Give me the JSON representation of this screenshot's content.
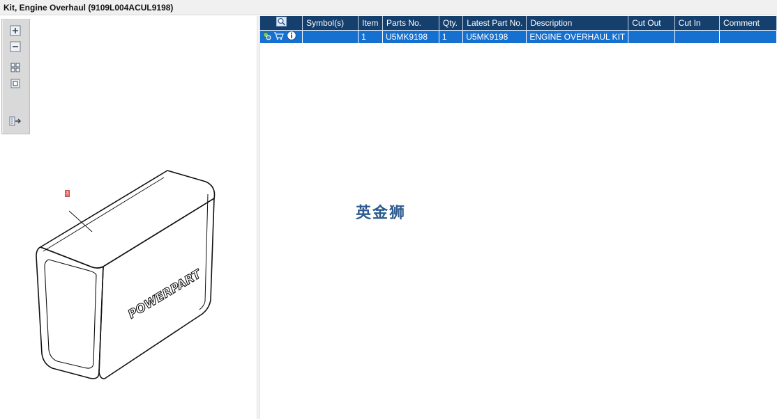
{
  "window": {
    "title": "Kit, Engine Overhaul (9109L004ACUL9198)"
  },
  "toolbar": {
    "buttons": [
      {
        "name": "zoom-in-icon"
      },
      {
        "name": "zoom-out-icon"
      },
      {
        "name": "fit-all-icon"
      },
      {
        "name": "actual-size-icon"
      },
      {
        "name": "panel-toggle-icon"
      }
    ]
  },
  "drawing": {
    "callout": "1",
    "brand_text": "POWERPART"
  },
  "table": {
    "headers": {
      "view": "",
      "symbols": "Symbol(s)",
      "item": "Item",
      "parts_no": "Parts No.",
      "qty": "Qty.",
      "latest_part_no": "Latest Part No.",
      "description": "Description",
      "cut_out": "Cut Out",
      "cut_in": "Cut In",
      "comment": "Comment"
    },
    "rows": [
      {
        "symbols": "",
        "item": "1",
        "parts_no": "U5MK9198",
        "qty": "1",
        "latest_part_no": "U5MK9198",
        "description": "ENGINE OVERHAUL KIT",
        "cut_out": "",
        "cut_in": "",
        "comment": ""
      }
    ]
  },
  "watermark": {
    "text": "英金狮"
  },
  "colors": {
    "header_bg": "#15406e",
    "row_selected_bg": "#1670d0",
    "watermark": "#2d5a8e"
  }
}
